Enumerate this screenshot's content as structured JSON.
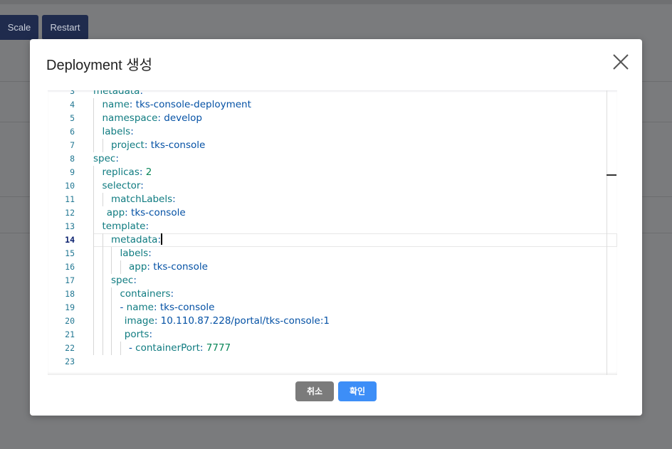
{
  "background": {
    "buttons": {
      "scale": "Scale",
      "restart": "Restart"
    }
  },
  "modal": {
    "title": "Deployment 생성",
    "buttons": {
      "cancel": "취소",
      "confirm": "확인"
    },
    "colors": {
      "confirm": "#3d8ef7",
      "cancel": "#7b7b7b",
      "yaml_key": "#0f7b80",
      "yaml_value": "#0451a5",
      "yaml_number": "#098658"
    },
    "editor": {
      "active_line": 14,
      "lines": [
        {
          "n": "3",
          "indent": 0,
          "key": "metadata",
          "value": "",
          "dash": false
        },
        {
          "n": "4",
          "indent": 1,
          "key": "name",
          "value": "tks-console-deployment",
          "dash": false
        },
        {
          "n": "5",
          "indent": 1,
          "key": "namespace",
          "value": "develop",
          "dash": false
        },
        {
          "n": "6",
          "indent": 1,
          "key": "labels",
          "value": "",
          "dash": false
        },
        {
          "n": "7",
          "indent": 2,
          "key": "project",
          "value": "tks-console",
          "dash": false
        },
        {
          "n": "8",
          "indent": 0,
          "key": "spec",
          "value": "",
          "dash": false
        },
        {
          "n": "9",
          "indent": 1,
          "key": "replicas",
          "value": "2",
          "dash": false,
          "numeric": true
        },
        {
          "n": "10",
          "indent": 1,
          "key": "selector",
          "value": "",
          "dash": false
        },
        {
          "n": "11",
          "indent": 2,
          "key": "matchLabels",
          "value": "",
          "dash": false
        },
        {
          "n": "12",
          "indent": 1.5,
          "key": "app",
          "value": "tks-console",
          "dash": false
        },
        {
          "n": "13",
          "indent": 1,
          "key": "template",
          "value": "",
          "dash": false
        },
        {
          "n": "14",
          "indent": 2,
          "key": "metadata",
          "value": "",
          "dash": false
        },
        {
          "n": "15",
          "indent": 3,
          "key": "labels",
          "value": "",
          "dash": false
        },
        {
          "n": "16",
          "indent": 4,
          "key": "app",
          "value": "tks-console",
          "dash": false
        },
        {
          "n": "17",
          "indent": 2,
          "key": "spec",
          "value": "",
          "dash": false
        },
        {
          "n": "18",
          "indent": 3,
          "key": "containers",
          "value": "",
          "dash": false
        },
        {
          "n": "19",
          "indent": 3,
          "key": "name",
          "value": "tks-console",
          "dash": true
        },
        {
          "n": "20",
          "indent": 3.5,
          "key": "image",
          "value": "10.110.87.228/portal/tks-console:1",
          "dash": false
        },
        {
          "n": "21",
          "indent": 3.5,
          "key": "ports",
          "value": "",
          "dash": false
        },
        {
          "n": "22",
          "indent": 4,
          "key": "containerPort",
          "value": "7777",
          "dash": true,
          "numeric": true
        },
        {
          "n": "23",
          "indent": 0,
          "key": "",
          "value": "",
          "dash": false
        }
      ]
    }
  }
}
